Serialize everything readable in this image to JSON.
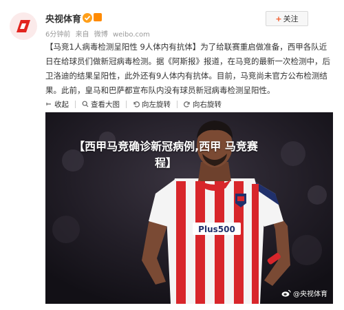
{
  "post": {
    "author": "央视体育",
    "meta": {
      "time": "6分钟前",
      "source_prefix": "来自",
      "source": "微博",
      "site": "weibo.com"
    },
    "follow_label": "关注",
    "text": "【马竞1人病毒检测呈阳性 9人体内有抗体】为了给联赛重启做准备，西甲各队近日在给球员们做新冠病毒检测。据《阿斯报》报道，在马竞的最新一次检测中，后卫洛迪的结果呈阳性，此外还有9人体内有抗体。目前，马竞尚未官方公布检测结果。此前，皇马和巴萨都宣布队内没有球员新冠病毒检测呈阳性。",
    "actions": {
      "collapse": "收起",
      "view_large": "查看大图",
      "rotate_left": "向左旋转",
      "rotate_right": "向右旋转"
    },
    "image": {
      "headline_line1": "【西甲马竞确诊新冠病例,西甲 马竞赛",
      "headline_line2": "程】",
      "jersey_sponsor": "Plus500",
      "watermark": "@央视体育"
    }
  },
  "colors": {
    "brand_red": "#e2251f",
    "jersey_red": "#d8262b",
    "jersey_white": "#f4f4f4",
    "sponsor_blue": "#20306b"
  }
}
